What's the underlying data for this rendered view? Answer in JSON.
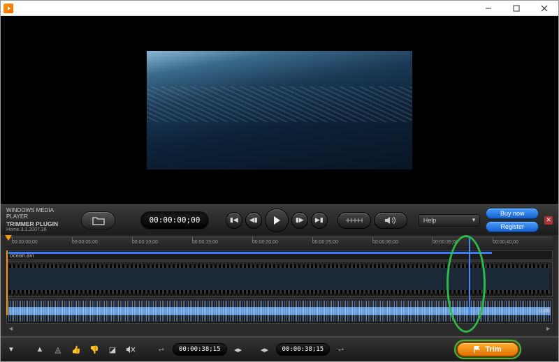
{
  "titlebar": {
    "app_icon": "media-player-icon"
  },
  "brand": {
    "line1": "WINDOWS MEDIA PLAYER",
    "line2": "TRIMMER PLUGIN",
    "version": "Home 3.1.2007.28"
  },
  "toolbar": {
    "open_label": "Open",
    "timecode": "00:00:00;00",
    "help_label": "Help",
    "buy_label": "Buy now",
    "register_label": "Register"
  },
  "timeline": {
    "ticks": [
      "00:00:00;00",
      "00:00:05;00",
      "00:00:10;00",
      "00:00:15;00",
      "00:00:20;00",
      "00:00:25;00",
      "00:00:30;00",
      "00:00:35;00",
      "00:00:40;00"
    ],
    "clip_name": "ocean.avi",
    "total_duration": "0:46",
    "playhead_pct": 84
  },
  "footer": {
    "in_time": "00:00:38;15",
    "out_time": "00:00:38;15",
    "trim_label": "Trim"
  }
}
